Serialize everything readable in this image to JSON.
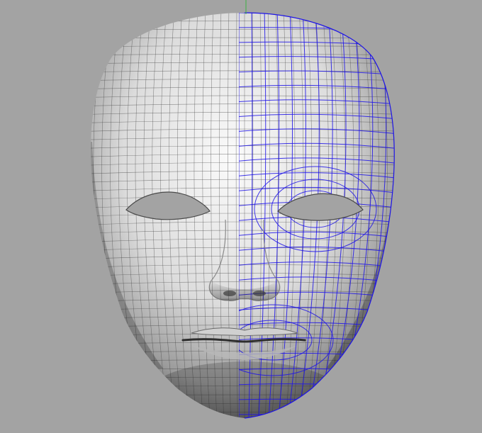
{
  "viewport": {
    "background_color": "#a3a3a3",
    "view_axis_color": "#3cb043",
    "selection_wire_color": "#1e14e6",
    "base_wire_color": "#3c3c3c",
    "mesh_fill_light": "#f7f7f7",
    "mesh_fill_dark": "#5e5e5e",
    "object": "face-mask-mesh",
    "symmetry": "left-right",
    "selected_half": "right"
  }
}
